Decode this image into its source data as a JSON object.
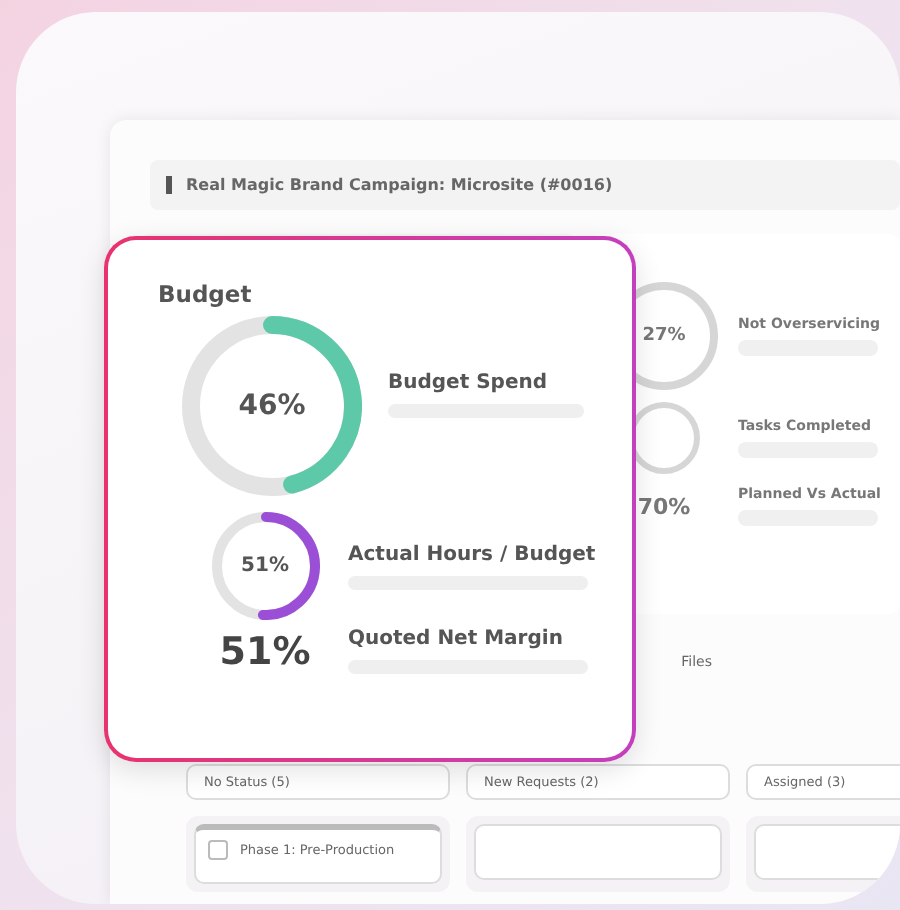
{
  "window": {
    "title": "Real Magic Brand Campaign: Microsite (#0016)"
  },
  "tracking": {
    "metrics": [
      {
        "kind": "ring-large",
        "value": "27%",
        "label": "Not Overservicing"
      },
      {
        "kind": "ring-small",
        "label": "Tasks Completed"
      },
      {
        "kind": "plain",
        "value": "70%",
        "label": "Planned Vs Actual"
      }
    ]
  },
  "tabs": [
    {
      "label": "Files",
      "selected": false
    }
  ],
  "status_columns": [
    {
      "label": "No Status (5)",
      "cards": [
        {
          "title": "Phase 1: Pre-Production",
          "checked": false
        }
      ]
    },
    {
      "label": "New Requests (2)"
    },
    {
      "label": "Assigned (3)"
    }
  ],
  "budget": {
    "title": "Budget",
    "metrics": [
      {
        "kind": "ring-large",
        "value": "46%",
        "label": "Budget Spend",
        "level": 0.46,
        "color": "#5ec9a8"
      },
      {
        "kind": "ring-small",
        "value": "51%",
        "label": "Actual Hours / Budget",
        "level": 0.51,
        "color": "#9b4fd6"
      },
      {
        "kind": "plain",
        "value": "51%",
        "label": "Quoted Net Margin"
      }
    ]
  }
}
